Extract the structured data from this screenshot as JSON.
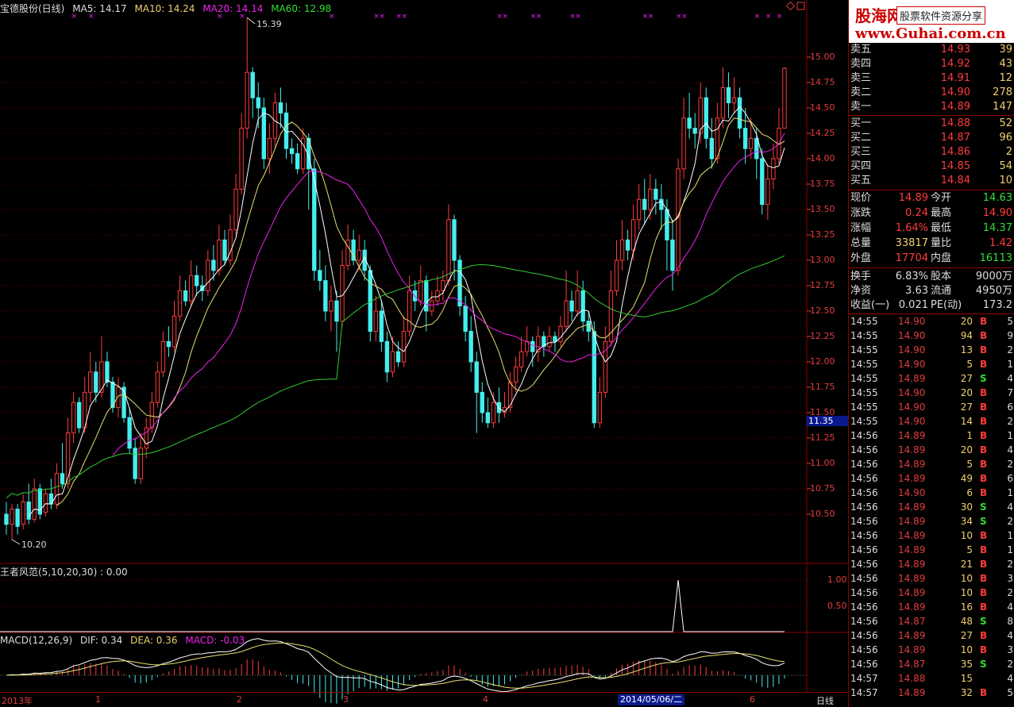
{
  "chart_header": {
    "stock": "宝德股份(日线)",
    "ma5": "MA5: 14.17",
    "ma10": "MA10: 14.24",
    "ma20": "MA20: 14.14",
    "ma60": "MA60: 12.98",
    "high_mark": "15.39",
    "low_mark": "10.20"
  },
  "indicator1": {
    "label": "王者风范(5,10,20,30) : 0.00",
    "ticks": [
      "1.00",
      "0.50"
    ]
  },
  "indicator2": {
    "name": "MACD(12,26,9)",
    "dif": "DIF: 0.34",
    "dea": "DEA: 0.36",
    "macd": "MACD: -0.03"
  },
  "price_axis": [
    "15.00",
    "14.75",
    "14.50",
    "14.25",
    "14.00",
    "13.75",
    "13.50",
    "13.25",
    "13.00",
    "12.75",
    "12.50",
    "12.25",
    "12.00",
    "11.75",
    "11.50",
    "11.25",
    "11.00",
    "10.75",
    "10.50"
  ],
  "current_price_box": "11.35",
  "bottom_axis": {
    "ticks": [
      "2013年",
      "1",
      "2",
      "3",
      "4",
      "6"
    ],
    "date_box": "2014/05/06/二",
    "period": "日线"
  },
  "logo": {
    "name": "股海网",
    "slogan": "股票软件资源分享",
    "url": "www.Guhai.com.cn"
  },
  "sell_orders": [
    {
      "label": "卖五",
      "price": "14.93",
      "vol": "39"
    },
    {
      "label": "卖四",
      "price": "14.92",
      "vol": "43"
    },
    {
      "label": "卖三",
      "price": "14.91",
      "vol": "12"
    },
    {
      "label": "卖二",
      "price": "14.90",
      "vol": "278"
    },
    {
      "label": "卖一",
      "price": "14.89",
      "vol": "147"
    }
  ],
  "buy_orders": [
    {
      "label": "买一",
      "price": "14.88",
      "vol": "52"
    },
    {
      "label": "买二",
      "price": "14.87",
      "vol": "96"
    },
    {
      "label": "买三",
      "price": "14.86",
      "vol": "2"
    },
    {
      "label": "买四",
      "price": "14.85",
      "vol": "54"
    },
    {
      "label": "买五",
      "price": "14.84",
      "vol": "10"
    }
  ],
  "stats_a": [
    {
      "l1": "现价",
      "v1": "14.89",
      "c1": "red",
      "l2": "今开",
      "v2": "14.63",
      "c2": "green"
    },
    {
      "l1": "涨跌",
      "v1": "0.24",
      "c1": "red",
      "l2": "最高",
      "v2": "14.90",
      "c2": "red"
    },
    {
      "l1": "涨幅",
      "v1": "1.64%",
      "c1": "red",
      "l2": "最低",
      "v2": "14.37",
      "c2": "green"
    },
    {
      "l1": "总量",
      "v1": "33817",
      "c1": "yellow",
      "l2": "量比",
      "v2": "1.42",
      "c2": "red"
    },
    {
      "l1": "外盘",
      "v1": "17704",
      "c1": "red",
      "l2": "内盘",
      "v2": "16113",
      "c2": "green"
    }
  ],
  "stats_b": [
    {
      "l1": "换手",
      "v1": "6.83%",
      "c1": "white",
      "l2": "股本",
      "v2": "9000万",
      "c2": "white"
    },
    {
      "l1": "净资",
      "v1": "3.63",
      "c1": "white",
      "l2": "流通",
      "v2": "4950万",
      "c2": "white"
    },
    {
      "l1": "收益(一)",
      "v1": "0.021",
      "c1": "white",
      "l2": "PE(动)",
      "v2": "173.2",
      "c2": "white"
    }
  ],
  "ticks": [
    {
      "t": "14:55",
      "p": "14.90",
      "v": "20",
      "bs": "B",
      "n": "5"
    },
    {
      "t": "14:55",
      "p": "14.90",
      "v": "94",
      "bs": "B",
      "n": "9"
    },
    {
      "t": "14:55",
      "p": "14.90",
      "v": "13",
      "bs": "B",
      "n": "2"
    },
    {
      "t": "14:55",
      "p": "14.90",
      "v": "5",
      "bs": "B",
      "n": "1"
    },
    {
      "t": "14:55",
      "p": "14.89",
      "v": "27",
      "bs": "S",
      "n": "4"
    },
    {
      "t": "14:55",
      "p": "14.90",
      "v": "20",
      "bs": "B",
      "n": "7"
    },
    {
      "t": "14:55",
      "p": "14.90",
      "v": "27",
      "bs": "B",
      "n": "6"
    },
    {
      "t": "14:55",
      "p": "14.90",
      "v": "14",
      "bs": "B",
      "n": "2"
    },
    {
      "t": "14:56",
      "p": "14.89",
      "v": "1",
      "bs": "B",
      "n": "1"
    },
    {
      "t": "14:56",
      "p": "14.89",
      "v": "20",
      "bs": "B",
      "n": "4"
    },
    {
      "t": "14:56",
      "p": "14.89",
      "v": "5",
      "bs": "B",
      "n": "2"
    },
    {
      "t": "14:56",
      "p": "14.89",
      "v": "49",
      "bs": "B",
      "n": "6"
    },
    {
      "t": "14:56",
      "p": "14.90",
      "v": "6",
      "bs": "B",
      "n": "1"
    },
    {
      "t": "14:56",
      "p": "14.89",
      "v": "30",
      "bs": "S",
      "n": "4"
    },
    {
      "t": "14:56",
      "p": "14.89",
      "v": "34",
      "bs": "S",
      "n": "2"
    },
    {
      "t": "14:56",
      "p": "14.89",
      "v": "10",
      "bs": "B",
      "n": "1"
    },
    {
      "t": "14:56",
      "p": "14.89",
      "v": "5",
      "bs": "B",
      "n": "1"
    },
    {
      "t": "14:56",
      "p": "14.89",
      "v": "21",
      "bs": "B",
      "n": "2"
    },
    {
      "t": "14:56",
      "p": "14.89",
      "v": "10",
      "bs": "B",
      "n": "3"
    },
    {
      "t": "14:56",
      "p": "14.89",
      "v": "10",
      "bs": "B",
      "n": "2"
    },
    {
      "t": "14:56",
      "p": "14.89",
      "v": "16",
      "bs": "B",
      "n": "4"
    },
    {
      "t": "14:56",
      "p": "14.87",
      "v": "48",
      "bs": "S",
      "n": "8"
    },
    {
      "t": "14:56",
      "p": "14.89",
      "v": "27",
      "bs": "B",
      "n": "4"
    },
    {
      "t": "14:56",
      "p": "14.89",
      "v": "10",
      "bs": "B",
      "n": "3"
    },
    {
      "t": "14:56",
      "p": "14.87",
      "v": "35",
      "bs": "S",
      "n": "2"
    },
    {
      "t": "14:57",
      "p": "14.88",
      "v": "15",
      "bs": "",
      "n": "4"
    },
    {
      "t": "14:57",
      "p": "14.89",
      "v": "32",
      "bs": "B",
      "n": "5"
    }
  ],
  "colors": {
    "up": "#ff3b3b",
    "down": "#44eeee",
    "ma5": "#ffffff",
    "ma10": "#e8e070",
    "ma20": "#ee22ee",
    "ma60": "#33cc33"
  },
  "chart_data": {
    "type": "candlestick",
    "price_range": [
      10.2,
      15.39
    ],
    "candles": [
      [
        10.5,
        10.4,
        10.62,
        10.3
      ],
      [
        10.4,
        10.55,
        10.6,
        10.25
      ],
      [
        10.55,
        10.38,
        10.6,
        10.3
      ],
      [
        10.4,
        10.62,
        10.7,
        10.35
      ],
      [
        10.62,
        10.45,
        10.8,
        10.4
      ],
      [
        10.45,
        10.75,
        10.85,
        10.42
      ],
      [
        10.75,
        10.5,
        10.8,
        10.45
      ],
      [
        10.52,
        10.7,
        10.75,
        10.48
      ],
      [
        10.7,
        10.6,
        10.85,
        10.55
      ],
      [
        10.6,
        10.9,
        11.0,
        10.55
      ],
      [
        10.9,
        10.8,
        11.2,
        10.75
      ],
      [
        10.8,
        11.3,
        11.45,
        10.75
      ],
      [
        11.3,
        11.6,
        11.7,
        11.2
      ],
      [
        11.6,
        11.35,
        11.65,
        11.3
      ],
      [
        11.35,
        11.7,
        11.85,
        11.3
      ],
      [
        11.7,
        11.9,
        12.1,
        11.6
      ],
      [
        11.9,
        11.7,
        12.0,
        11.6
      ],
      [
        11.7,
        12.0,
        12.25,
        11.65
      ],
      [
        12.0,
        11.8,
        12.1,
        11.75
      ],
      [
        11.8,
        11.55,
        11.85,
        11.5
      ],
      [
        11.55,
        11.75,
        11.85,
        11.45
      ],
      [
        11.75,
        11.45,
        11.8,
        11.4
      ],
      [
        11.45,
        11.15,
        11.55,
        11.1
      ],
      [
        11.15,
        10.85,
        11.25,
        10.8
      ],
      [
        10.85,
        11.15,
        11.3,
        10.8
      ],
      [
        11.15,
        11.35,
        11.45,
        11.05
      ],
      [
        11.35,
        11.6,
        11.7,
        11.3
      ],
      [
        11.6,
        11.9,
        12.0,
        11.55
      ],
      [
        11.9,
        12.2,
        12.3,
        11.85
      ],
      [
        12.2,
        12.15,
        12.35,
        12.05
      ],
      [
        12.15,
        12.45,
        12.6,
        12.1
      ],
      [
        12.45,
        12.7,
        12.85,
        12.4
      ],
      [
        12.7,
        12.6,
        12.8,
        12.55
      ],
      [
        12.6,
        12.85,
        13.0,
        12.55
      ],
      [
        12.85,
        12.75,
        12.95,
        12.65
      ],
      [
        12.75,
        12.7,
        12.85,
        12.6
      ],
      [
        12.7,
        13.0,
        13.1,
        12.65
      ],
      [
        13.0,
        12.9,
        13.15,
        12.8
      ],
      [
        12.9,
        13.2,
        13.35,
        12.85
      ],
      [
        13.2,
        13.0,
        13.3,
        12.95
      ],
      [
        13.0,
        13.3,
        13.45,
        12.95
      ],
      [
        13.3,
        13.7,
        13.85,
        13.25
      ],
      [
        13.7,
        14.3,
        14.45,
        13.65
      ],
      [
        14.3,
        14.85,
        15.39,
        14.2
      ],
      [
        14.85,
        14.6,
        14.9,
        14.4
      ],
      [
        14.6,
        14.5,
        14.75,
        14.3
      ],
      [
        14.5,
        14.0,
        14.6,
        13.9
      ],
      [
        14.0,
        14.2,
        14.35,
        13.85
      ],
      [
        14.2,
        14.55,
        14.65,
        14.1
      ],
      [
        14.55,
        14.45,
        14.7,
        14.3
      ],
      [
        14.45,
        14.1,
        14.55,
        14.0
      ],
      [
        14.1,
        14.05,
        14.2,
        13.95
      ],
      [
        14.05,
        13.9,
        14.15,
        13.85
      ],
      [
        13.9,
        14.2,
        14.3,
        13.85
      ],
      [
        14.2,
        13.9,
        14.25,
        13.5
      ],
      [
        13.9,
        12.9,
        14.0,
        12.8
      ],
      [
        12.9,
        12.8,
        13.1,
        12.7
      ],
      [
        12.8,
        12.5,
        12.95,
        12.4
      ],
      [
        12.5,
        12.6,
        12.75,
        12.3
      ],
      [
        12.6,
        12.4,
        12.7,
        12.1
      ],
      [
        12.4,
        12.95,
        13.1,
        12.35
      ],
      [
        12.95,
        13.2,
        13.35,
        12.9
      ],
      [
        13.2,
        13.0,
        13.3,
        12.95
      ],
      [
        13.0,
        13.1,
        13.25,
        12.9
      ],
      [
        13.1,
        12.9,
        13.2,
        12.8
      ],
      [
        12.9,
        12.3,
        12.95,
        12.2
      ],
      [
        12.3,
        12.5,
        12.65,
        12.2
      ],
      [
        12.5,
        12.2,
        12.6,
        12.1
      ],
      [
        12.2,
        11.9,
        12.3,
        11.8
      ],
      [
        11.9,
        12.1,
        12.25,
        11.85
      ],
      [
        12.1,
        12.0,
        12.2,
        11.95
      ],
      [
        12.0,
        12.3,
        12.45,
        11.95
      ],
      [
        12.3,
        12.7,
        12.85,
        12.25
      ],
      [
        12.7,
        12.6,
        12.8,
        12.5
      ],
      [
        12.6,
        12.8,
        12.95,
        12.55
      ],
      [
        12.8,
        12.5,
        12.85,
        12.3
      ],
      [
        12.5,
        12.6,
        12.7,
        12.45
      ],
      [
        12.6,
        12.7,
        12.85,
        12.55
      ],
      [
        12.7,
        12.8,
        12.9,
        12.6
      ],
      [
        12.8,
        13.4,
        13.55,
        12.75
      ],
      [
        13.4,
        13.0,
        13.45,
        12.8
      ],
      [
        13.0,
        12.55,
        13.05,
        12.45
      ],
      [
        12.55,
        12.3,
        12.65,
        12.2
      ],
      [
        12.3,
        12.0,
        12.45,
        11.9
      ],
      [
        12.0,
        11.7,
        12.1,
        11.3
      ],
      [
        11.7,
        11.5,
        11.8,
        11.4
      ],
      [
        11.5,
        11.4,
        11.65,
        11.35
      ],
      [
        11.4,
        11.6,
        11.7,
        11.35
      ],
      [
        11.6,
        11.5,
        11.75,
        11.4
      ],
      [
        11.5,
        11.55,
        11.7,
        11.45
      ],
      [
        11.55,
        11.8,
        11.9,
        11.5
      ],
      [
        11.8,
        11.95,
        12.05,
        11.7
      ],
      [
        11.95,
        12.1,
        12.25,
        11.9
      ],
      [
        12.1,
        12.2,
        12.35,
        12.05
      ],
      [
        12.2,
        12.1,
        12.25,
        11.95
      ],
      [
        12.1,
        12.25,
        12.35,
        12.0
      ],
      [
        12.25,
        12.15,
        12.3,
        12.05
      ],
      [
        12.15,
        12.25,
        12.35,
        12.1
      ],
      [
        12.25,
        12.2,
        12.3,
        12.1
      ],
      [
        12.2,
        12.35,
        12.45,
        12.15
      ],
      [
        12.35,
        12.6,
        12.9,
        12.3
      ],
      [
        12.6,
        12.5,
        12.7,
        12.4
      ],
      [
        12.5,
        12.7,
        12.9,
        12.45
      ],
      [
        12.7,
        12.4,
        12.8,
        12.3
      ],
      [
        12.4,
        12.3,
        12.5,
        12.2
      ],
      [
        12.3,
        11.4,
        12.4,
        11.35
      ],
      [
        11.4,
        11.7,
        11.85,
        11.35
      ],
      [
        11.7,
        12.2,
        12.35,
        11.65
      ],
      [
        12.2,
        12.7,
        12.9,
        12.15
      ],
      [
        12.7,
        13.0,
        13.2,
        12.65
      ],
      [
        13.0,
        13.2,
        13.4,
        12.9
      ],
      [
        13.2,
        13.1,
        13.3,
        13.0
      ],
      [
        13.1,
        13.4,
        13.55,
        13.0
      ],
      [
        13.4,
        13.6,
        13.75,
        13.3
      ],
      [
        13.6,
        13.5,
        13.8,
        13.35
      ],
      [
        13.5,
        13.7,
        13.85,
        13.4
      ],
      [
        13.7,
        13.6,
        13.8,
        13.45
      ],
      [
        13.6,
        13.5,
        13.75,
        13.3
      ],
      [
        13.5,
        13.2,
        13.6,
        12.9
      ],
      [
        13.2,
        12.9,
        13.4,
        12.7
      ],
      [
        12.9,
        13.9,
        14.0,
        12.85
      ],
      [
        13.9,
        14.4,
        14.6,
        13.8
      ],
      [
        14.4,
        14.3,
        14.65,
        14.2
      ],
      [
        14.3,
        14.25,
        14.45,
        14.1
      ],
      [
        14.25,
        14.6,
        14.75,
        14.15
      ],
      [
        14.6,
        14.2,
        14.7,
        14.1
      ],
      [
        14.2,
        14.0,
        14.4,
        13.9
      ],
      [
        14.0,
        14.4,
        14.55,
        13.95
      ],
      [
        14.4,
        14.7,
        14.9,
        14.3
      ],
      [
        14.7,
        14.55,
        14.85,
        14.4
      ],
      [
        14.55,
        14.6,
        14.8,
        14.45
      ],
      [
        14.6,
        14.3,
        14.7,
        14.2
      ],
      [
        14.3,
        14.1,
        14.5,
        13.95
      ],
      [
        14.1,
        14.2,
        14.4,
        14.0
      ],
      [
        14.2,
        14.0,
        14.3,
        13.8
      ],
      [
        14.0,
        13.55,
        14.1,
        13.45
      ],
      [
        13.55,
        13.8,
        13.95,
        13.4
      ],
      [
        13.8,
        14.0,
        14.15,
        13.7
      ],
      [
        14.0,
        14.3,
        14.5,
        13.95
      ],
      [
        14.3,
        14.89,
        14.9,
        14.37
      ]
    ],
    "wzff_spike_index": 120,
    "wzff_range": [
      0,
      1
    ]
  }
}
